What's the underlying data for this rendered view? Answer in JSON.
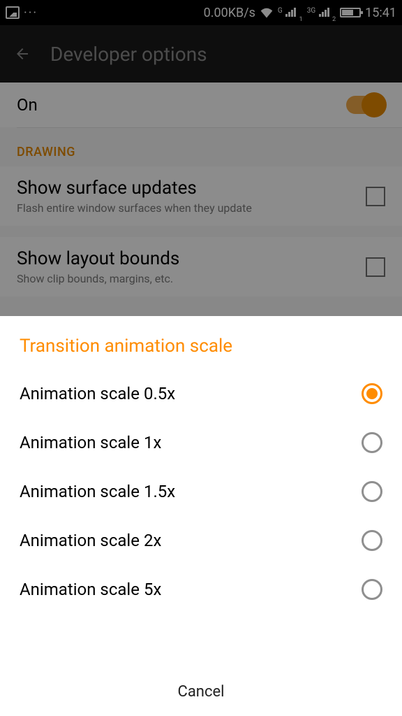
{
  "status_bar": {
    "dots": "···",
    "data_rate": "0.00KB/s",
    "net_g": "G",
    "net_3g": "3G",
    "sim1_sub": "1",
    "sim2_sub": "2",
    "time": "15:41"
  },
  "header": {
    "title": "Developer options"
  },
  "toggle_row": {
    "label": "On"
  },
  "drawing_section": {
    "title": "DRAWING",
    "items": [
      {
        "title": "Show surface updates",
        "sub": "Flash entire window surfaces when they update"
      },
      {
        "title": "Show layout bounds",
        "sub": "Show clip bounds, margins, etc."
      }
    ]
  },
  "dialog": {
    "title": "Transition animation scale",
    "options": [
      {
        "label": "Animation scale 0.5x",
        "selected": true
      },
      {
        "label": "Animation scale 1x",
        "selected": false
      },
      {
        "label": "Animation scale 1.5x",
        "selected": false
      },
      {
        "label": "Animation scale 2x",
        "selected": false
      },
      {
        "label": "Animation scale 5x",
        "selected": false
      }
    ],
    "cancel": "Cancel"
  }
}
